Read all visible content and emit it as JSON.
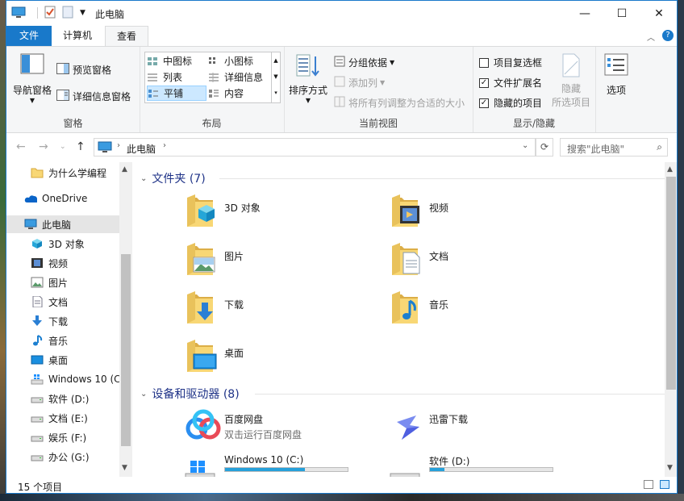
{
  "window": {
    "title": "此电脑",
    "minimize": "—",
    "maximize": "☐",
    "close": "✕"
  },
  "tabs": [
    {
      "label": "文件"
    },
    {
      "label": "计算机"
    },
    {
      "label": "查看"
    }
  ],
  "ribbon": {
    "panes": {
      "label": "窗格",
      "nav_pane": "导航窗格",
      "preview_pane": "预览窗格",
      "details_pane": "详细信息窗格"
    },
    "layout": {
      "label": "布局",
      "items": [
        "中图标",
        "小图标",
        "列表",
        "详细信息",
        "平铺",
        "内容"
      ]
    },
    "current_view": {
      "label": "当前视图",
      "sort_by": "排序方式",
      "group_by": "分组依据",
      "add_columns": "添加列",
      "size_all_columns": "将所有列调整为合适的大小"
    },
    "show_hide": {
      "label": "显示/隐藏",
      "item_checkboxes": "项目复选框",
      "file_name_extensions": "文件扩展名",
      "hidden_items": "隐藏的项目",
      "hide": "隐藏",
      "selected_items": "所选项目",
      "checkbox_states": {
        "item_checkboxes": false,
        "file_name_extensions": true,
        "hidden_items": true
      }
    },
    "options": "选项"
  },
  "address": {
    "path": "此电脑",
    "search_placeholder": "搜索\"此电脑\""
  },
  "nav_pane": {
    "items": [
      {
        "label": "为什么学编程",
        "icon": "folder-icon"
      },
      {
        "label": "OneDrive",
        "icon": "onedrive-icon"
      },
      {
        "label": "此电脑",
        "icon": "computer-icon"
      },
      {
        "label": "3D 对象",
        "icon": "3d-objects-icon"
      },
      {
        "label": "视频",
        "icon": "video-icon"
      },
      {
        "label": "图片",
        "icon": "pictures-icon"
      },
      {
        "label": "文档",
        "icon": "documents-icon"
      },
      {
        "label": "下载",
        "icon": "download-icon"
      },
      {
        "label": "音乐",
        "icon": "music-icon"
      },
      {
        "label": "桌面",
        "icon": "desktop-icon"
      },
      {
        "label": "Windows 10 (C",
        "icon": "windows-drive-icon"
      },
      {
        "label": "软件 (D:)",
        "icon": "drive-icon"
      },
      {
        "label": "文档 (E:)",
        "icon": "drive-icon"
      },
      {
        "label": "娱乐 (F:)",
        "icon": "drive-icon"
      },
      {
        "label": "办公 (G:)",
        "icon": "drive-icon"
      }
    ]
  },
  "content": {
    "folders_header": "文件夹 (7)",
    "folders": [
      {
        "name": "3D 对象",
        "icon": "3d-objects-folder-icon"
      },
      {
        "name": "视频",
        "icon": "video-folder-icon"
      },
      {
        "name": "图片",
        "icon": "pictures-folder-icon"
      },
      {
        "name": "文档",
        "icon": "documents-folder-icon"
      },
      {
        "name": "下载",
        "icon": "download-folder-icon"
      },
      {
        "name": "音乐",
        "icon": "music-folder-icon"
      },
      {
        "name": "桌面",
        "icon": "desktop-folder-icon"
      }
    ],
    "devices_header": "设备和驱动器 (8)",
    "devices": [
      {
        "name": "百度网盘",
        "subtitle": "双击运行百度网盘",
        "icon": "baidu-netdisk-icon"
      },
      {
        "name": "迅雷下载",
        "subtitle": "",
        "icon": "thunder-icon"
      },
      {
        "name": "Windows 10 (C:)",
        "usage": 0.65,
        "icon": "windows-drive-icon"
      },
      {
        "name": "软件 (D:)",
        "usage": 0.12,
        "icon": "drive-icon"
      }
    ]
  },
  "status": {
    "item_count": "15 个项目"
  },
  "colors": {
    "accent": "#1979ca",
    "selected": "#cce8ff",
    "header_text": "#1e3287",
    "bar_fill": "#26a0da"
  }
}
